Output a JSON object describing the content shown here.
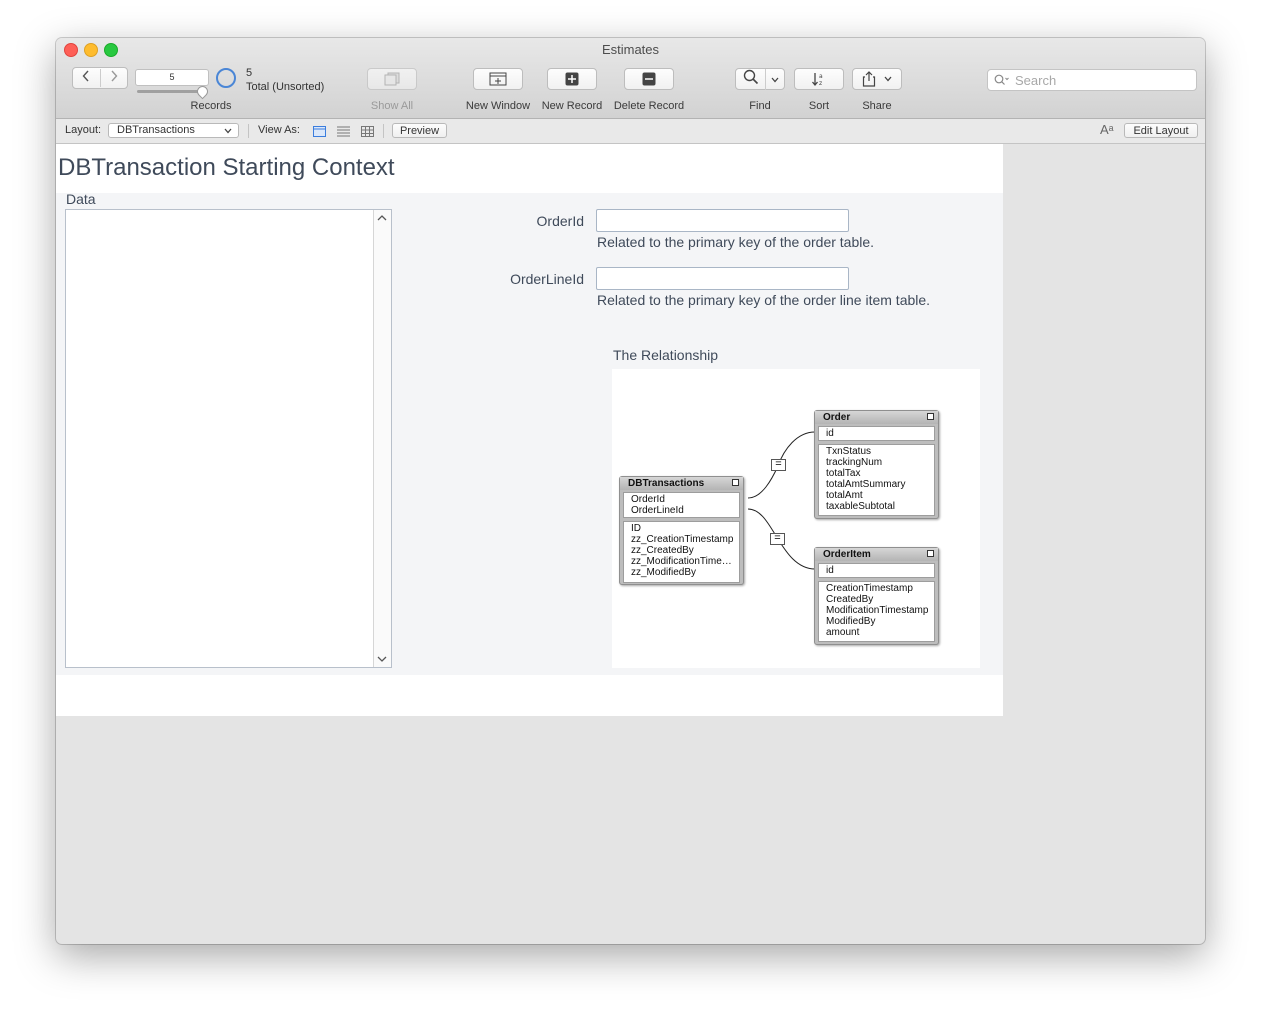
{
  "window": {
    "title": "Estimates"
  },
  "toolbar": {
    "record_number": "5",
    "records_label": "Records",
    "total_count": "5",
    "total_status": "Total (Unsorted)",
    "show_all_label": "Show All",
    "new_window_label": "New Window",
    "new_record_label": "New Record",
    "delete_record_label": "Delete Record",
    "find_label": "Find",
    "sort_label": "Sort",
    "share_label": "Share",
    "search_placeholder": "Search"
  },
  "layout_bar": {
    "layout_label": "Layout:",
    "layout_value": "DBTransactions",
    "view_as_label": "View As:",
    "preview_label": "Preview",
    "font_size_glyph": "Aᵃ",
    "edit_layout_label": "Edit Layout"
  },
  "main": {
    "heading": "DBTransaction Starting Context",
    "data_label": "Data",
    "fields": [
      {
        "label": "OrderId",
        "value": "",
        "help": "Related to the primary key of the order table."
      },
      {
        "label": "OrderLineId",
        "value": "",
        "help": "Related to the primary key of the order line item table."
      }
    ],
    "relationship_label": "The Relationship"
  },
  "diagram": {
    "tables": [
      {
        "name": "DBTransactions",
        "keys": [
          "OrderId",
          "OrderLineId"
        ],
        "fields": [
          "ID",
          "zz_CreationTimestamp",
          "zz_CreatedBy",
          "zz_ModificationTime…",
          "zz_ModifiedBy"
        ]
      },
      {
        "name": "Order",
        "keys": [
          "id"
        ],
        "fields": [
          "TxnStatus",
          "trackingNum",
          "totalTax",
          "totalAmtSummary",
          "totalAmt",
          "taxableSubtotal"
        ]
      },
      {
        "name": "OrderItem",
        "keys": [
          "id"
        ],
        "fields": [
          "CreationTimestamp",
          "CreatedBy",
          "ModificationTimestamp",
          "ModifiedBy",
          "amount"
        ]
      }
    ],
    "operator": "="
  }
}
